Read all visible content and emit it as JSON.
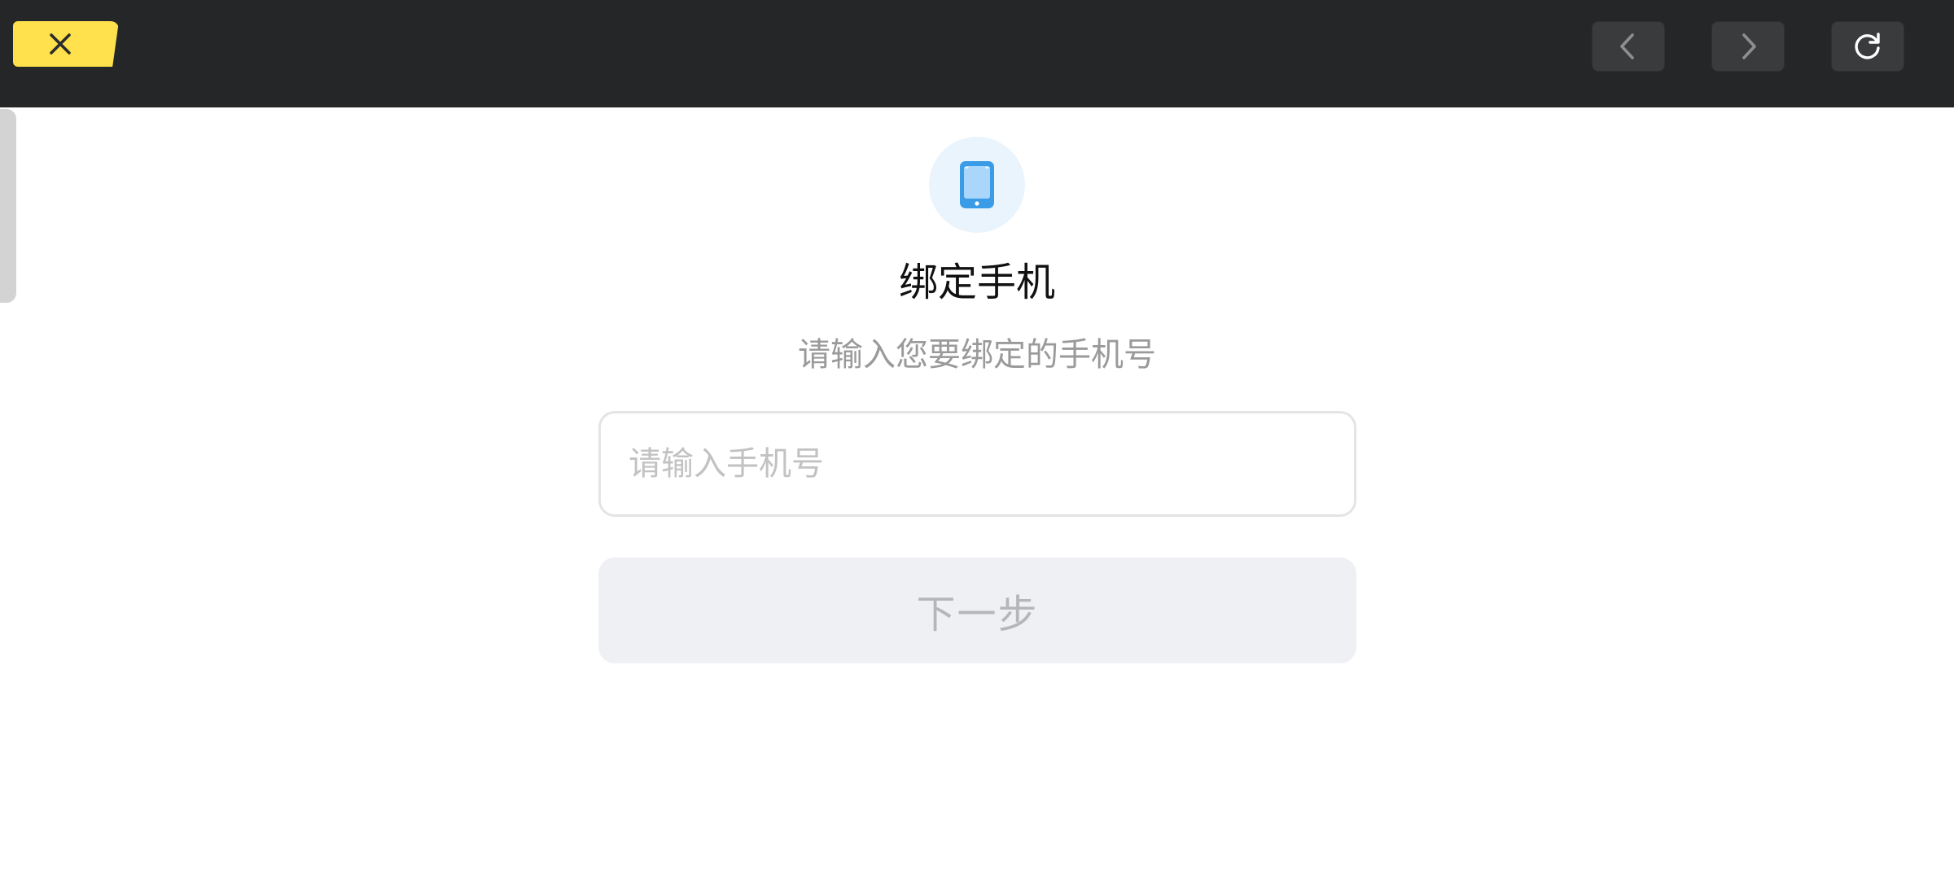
{
  "window": {
    "close_icon": "close-icon",
    "back_icon": "chevron-left-icon",
    "forward_icon": "chevron-right-icon",
    "refresh_icon": "refresh-icon"
  },
  "main": {
    "icon": "phone-icon",
    "title": "绑定手机",
    "subtitle": "请输入您要绑定的手机号",
    "phone_input": {
      "value": "",
      "placeholder": "请输入手机号"
    },
    "next_button_label": "下一步"
  },
  "colors": {
    "topbar_bg": "#252628",
    "close_tab_bg": "#FFE14D",
    "icon_badge_bg": "#EAF4FD",
    "phone_icon": "#3A9BE6",
    "disabled_button_bg": "#EFF0F4",
    "disabled_button_text": "#B6B6B8"
  }
}
